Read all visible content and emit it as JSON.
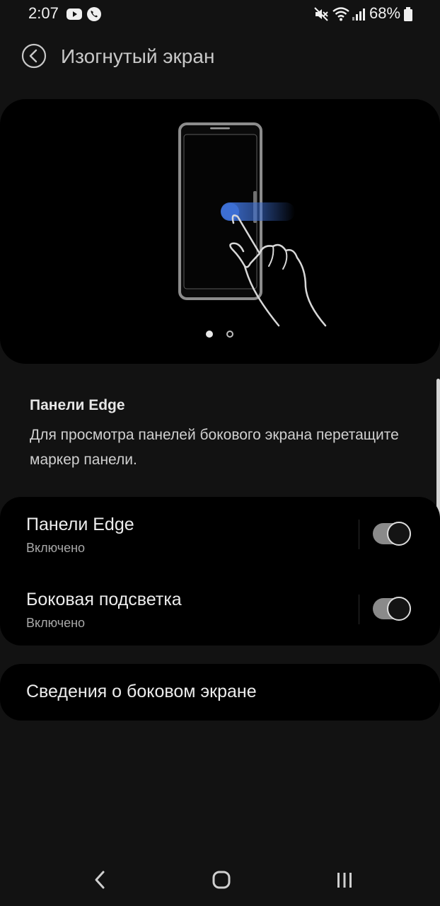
{
  "status_bar": {
    "time": "2:07",
    "battery_percent": "68%",
    "icons": [
      "youtube-icon",
      "phone-call-icon",
      "mute-icon",
      "wifi-icon",
      "signal-icon",
      "battery-icon"
    ]
  },
  "header": {
    "title": "Изогнутый экран",
    "back_icon": "back-arrow-circle-icon"
  },
  "illustration": {
    "description_icon": "edge-panel-swipe-illustration",
    "pages": 2,
    "active_page": 1,
    "accent_color": "#3d6fd4"
  },
  "info": {
    "title": "Панели Edge",
    "description": "Для просмотра панелей бокового экрана перетащите маркер панели."
  },
  "settings": {
    "items": [
      {
        "label": "Панели Edge",
        "status": "Включено",
        "enabled": true
      },
      {
        "label": "Боковая подсветка",
        "status": "Включено",
        "enabled": true
      }
    ]
  },
  "about": {
    "label": "Сведения о боковом экране"
  },
  "nav": {
    "back_icon": "nav-back-icon",
    "home_icon": "nav-home-icon",
    "recents_icon": "nav-recents-icon"
  },
  "colors": {
    "background": "#121212",
    "card": "#000000",
    "toggle_track": "#8a8a8a"
  }
}
